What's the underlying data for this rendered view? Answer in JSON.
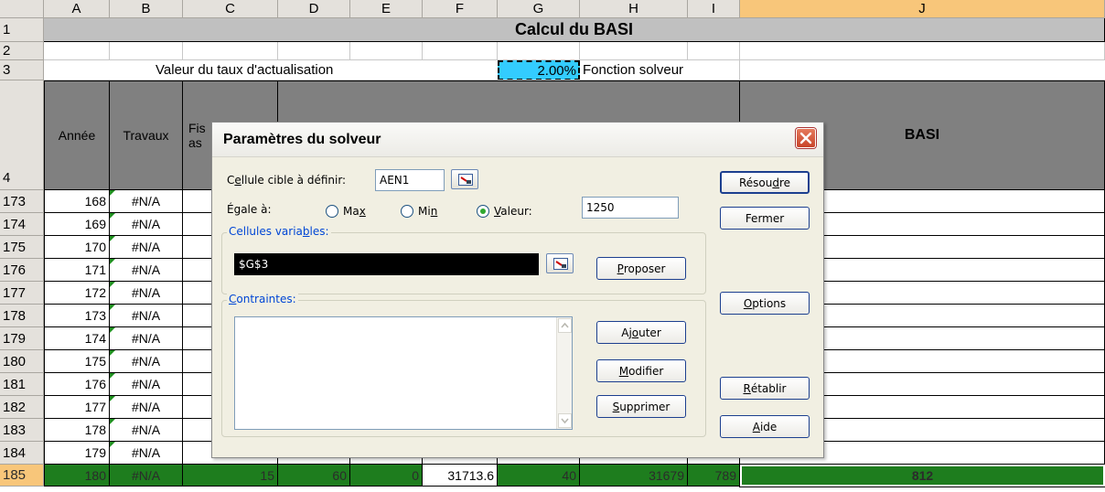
{
  "columns": [
    "A",
    "B",
    "C",
    "D",
    "E",
    "F",
    "G",
    "H",
    "I",
    "J"
  ],
  "title_row": {
    "row": "1",
    "text": "Calcul du BASI"
  },
  "row2": {
    "row": "2"
  },
  "row3": {
    "row": "3",
    "label": "Valeur du taux d'actualisation",
    "value": "2.00%",
    "note": "Fonction solveur"
  },
  "header_row": {
    "row": "4",
    "a": "Année",
    "b": "Travaux",
    "c_partial_top": "Fis",
    "c_partial_bottom": "as",
    "j": "BASI"
  },
  "data_rows": [
    {
      "row": "173",
      "year": "168",
      "travaux": "#N/A"
    },
    {
      "row": "174",
      "year": "169",
      "travaux": "#N/A"
    },
    {
      "row": "175",
      "year": "170",
      "travaux": "#N/A"
    },
    {
      "row": "176",
      "year": "171",
      "travaux": "#N/A"
    },
    {
      "row": "177",
      "year": "172",
      "travaux": "#N/A"
    },
    {
      "row": "178",
      "year": "173",
      "travaux": "#N/A"
    },
    {
      "row": "179",
      "year": "174",
      "travaux": "#N/A"
    },
    {
      "row": "180",
      "year": "175",
      "travaux": "#N/A"
    },
    {
      "row": "181",
      "year": "176",
      "travaux": "#N/A"
    },
    {
      "row": "182",
      "year": "177",
      "travaux": "#N/A"
    },
    {
      "row": "183",
      "year": "178",
      "travaux": "#N/A"
    },
    {
      "row": "184",
      "year": "179",
      "travaux": "#N/A"
    }
  ],
  "last_row": {
    "row": "185",
    "a": "180",
    "b": "#N/A",
    "c": "15",
    "d": "60",
    "e": "0",
    "f": "31713.6",
    "g": "40",
    "h": "31679",
    "i": "789",
    "j": "812"
  },
  "dialog": {
    "title": "Paramètres du solveur",
    "target_label_pre": "C",
    "target_label_u": "e",
    "target_label_post": "llule cible à définir:",
    "target_value": "AEN1",
    "equal_label": "Égale à:",
    "opt_max_pre": "Ma",
    "opt_max_u": "x",
    "opt_max_post": "",
    "opt_min_pre": "Mi",
    "opt_min_u": "n",
    "opt_min_post": "",
    "opt_val_pre": "",
    "opt_val_u": "V",
    "opt_val_post": "aleur:",
    "value_field": "1250",
    "variables_label_pre": "Cellules varia",
    "variables_label_u": "b",
    "variables_label_post": "les:",
    "variables_value": "$G$3",
    "constraints_label_pre": "",
    "constraints_label_u": "C",
    "constraints_label_post": "ontraintes:",
    "btn_solve_pre": "Résou",
    "btn_solve_u": "d",
    "btn_solve_post": "re",
    "btn_close": "Fermer",
    "btn_propose_pre": "",
    "btn_propose_u": "P",
    "btn_propose_post": "roposer",
    "btn_options_pre": "",
    "btn_options_u": "O",
    "btn_options_post": "ptions",
    "btn_add_pre": "Aj",
    "btn_add_u": "o",
    "btn_add_post": "uter",
    "btn_modify_pre": "",
    "btn_modify_u": "M",
    "btn_modify_post": "odifier",
    "btn_delete_pre": "",
    "btn_delete_u": "S",
    "btn_delete_post": "upprimer",
    "btn_reset_pre": "",
    "btn_reset_u": "R",
    "btn_reset_post": "établir",
    "btn_help_pre": "",
    "btn_help_u": "A",
    "btn_help_post": "ide"
  },
  "colors": {
    "header_bg": "#e4e1dc",
    "selected_header": "#f8c67a",
    "title_bg": "#c0c0c0",
    "table_header_bg": "#808080",
    "highlight_cell": "#33ccff",
    "total_row_green": "#1e7d1e",
    "dialog_bg": "#f1efe2"
  }
}
